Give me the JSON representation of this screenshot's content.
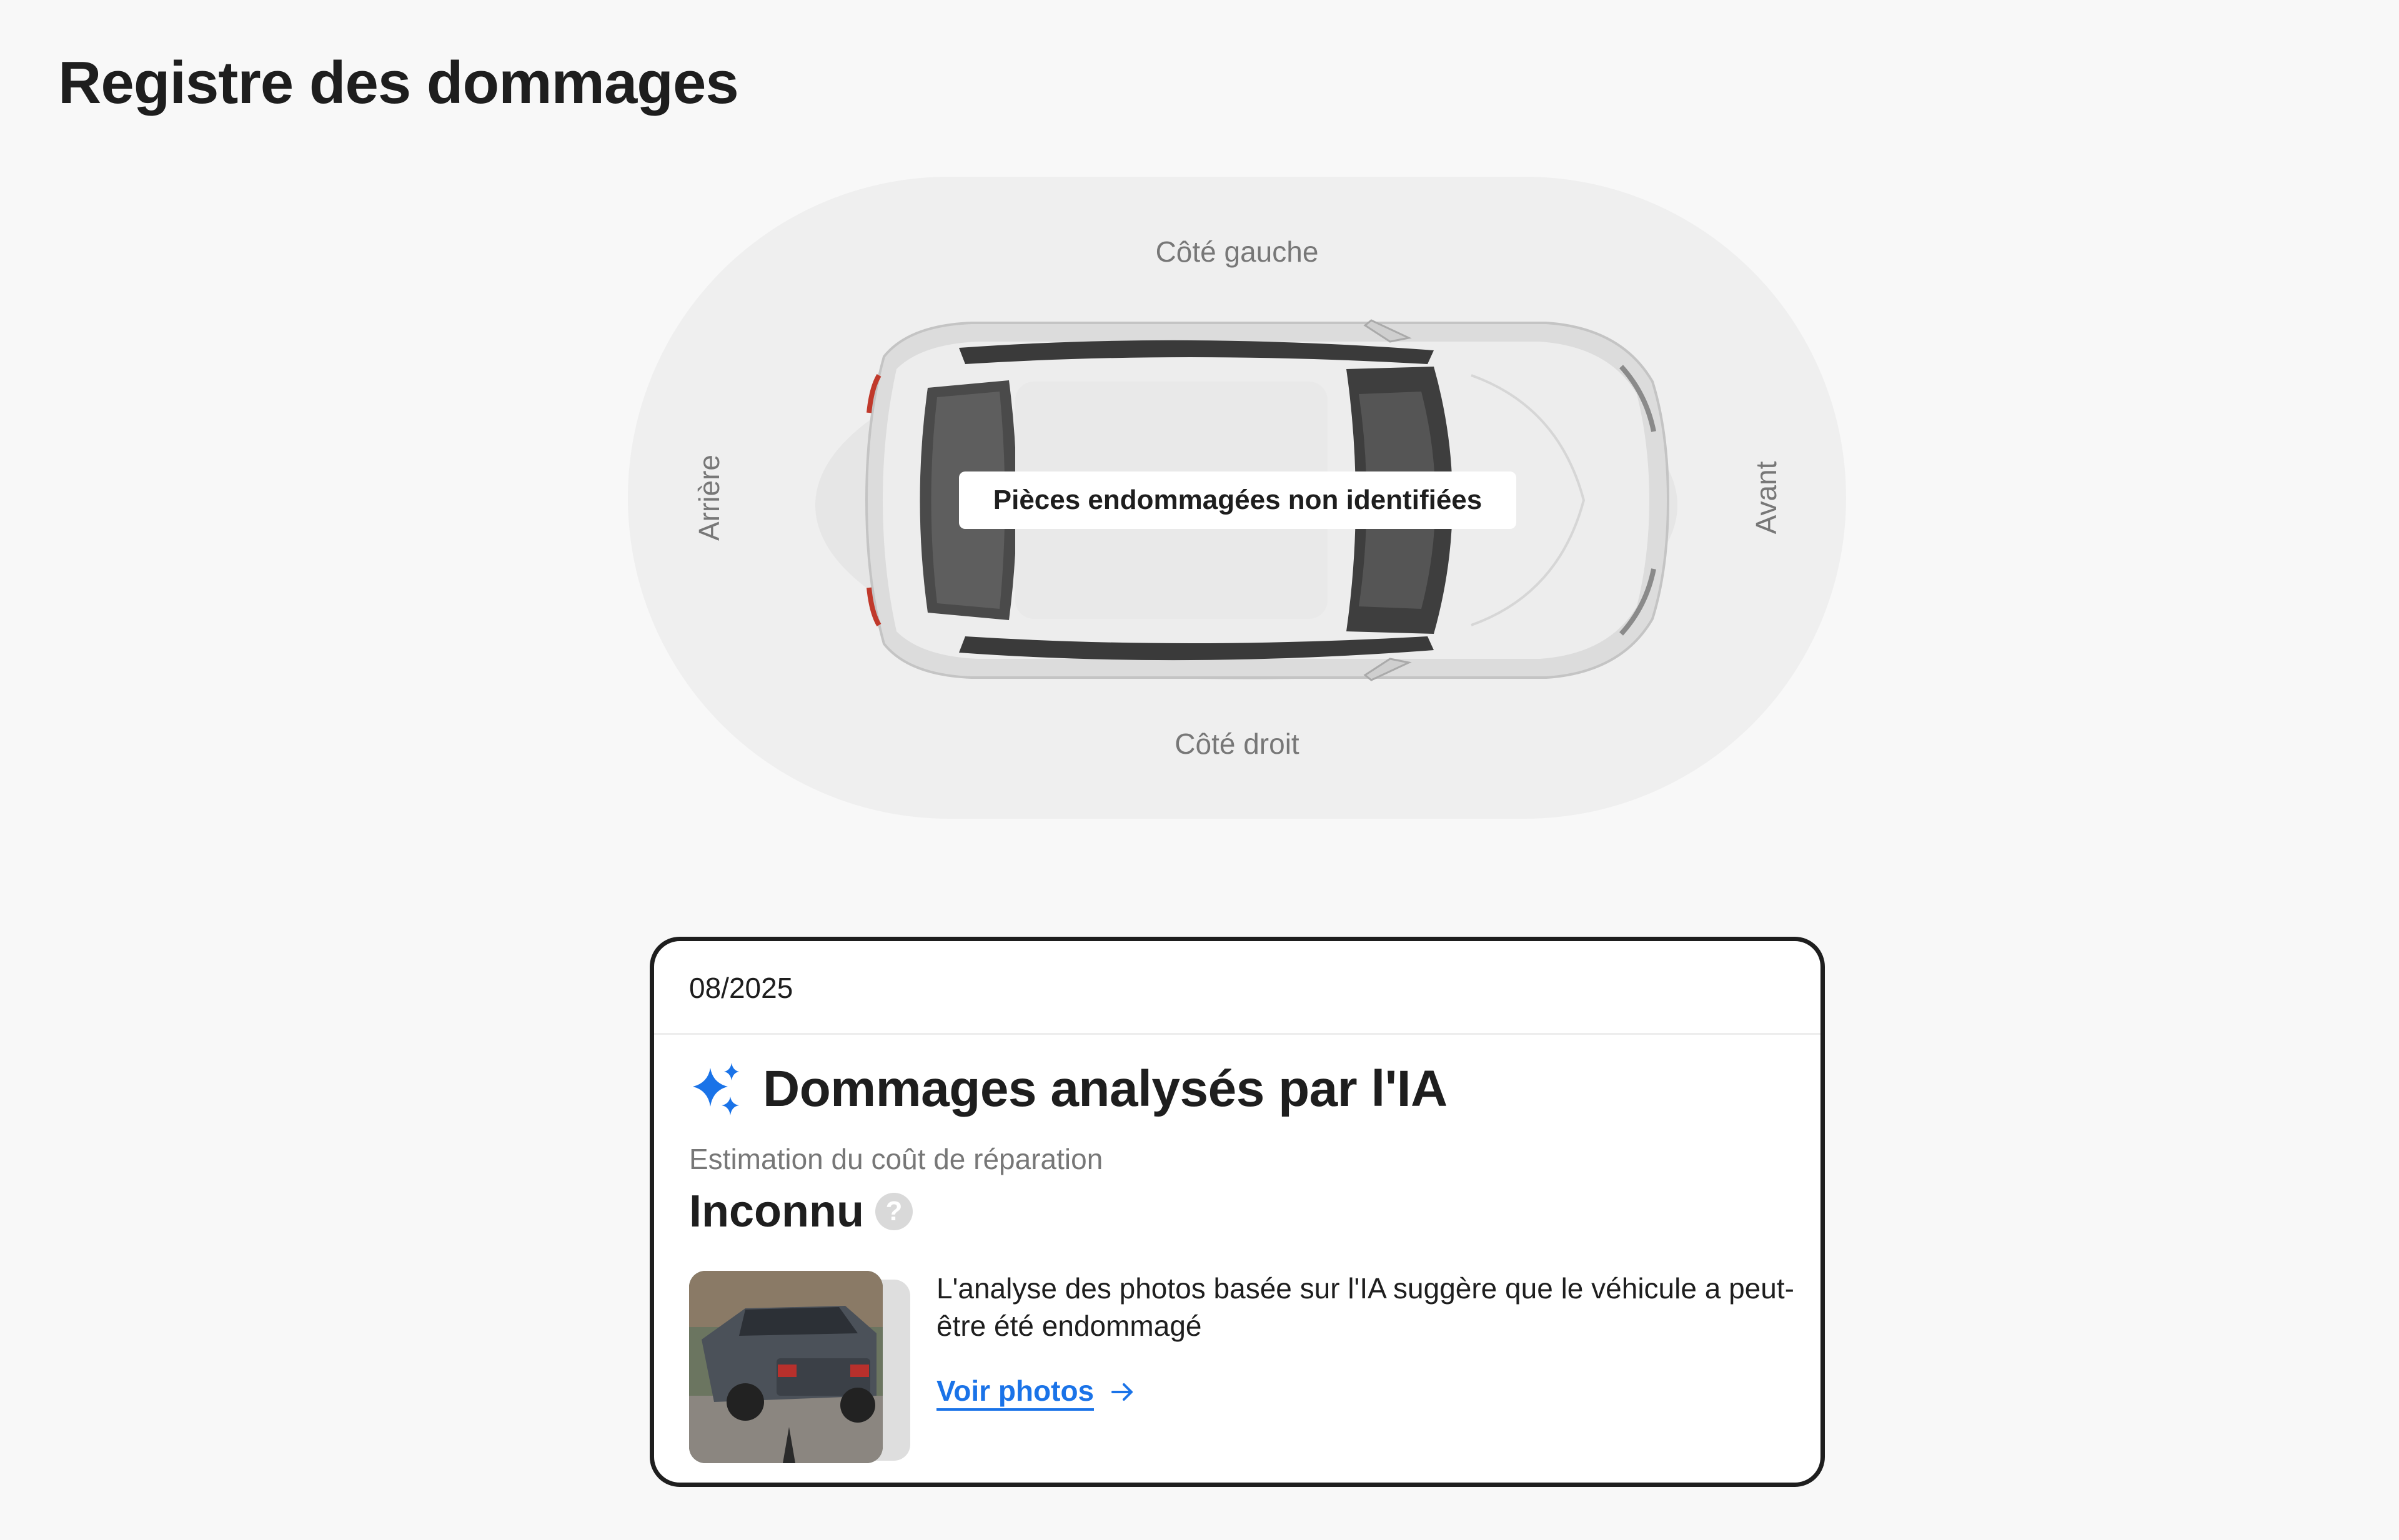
{
  "page": {
    "title": "Registre des dommages"
  },
  "diagram": {
    "left_side_label": "Côté gauche",
    "right_side_label": "Côté droit",
    "rear_label": "Arrière",
    "front_label": "Avant",
    "damage_status": "Pièces endommagées non identifiées"
  },
  "report": {
    "date": "08/2025",
    "ai_title": "Dommages analysés par l'IA",
    "estimate_label": "Estimation du coût de réparation",
    "estimate_value": "Inconnu",
    "help_symbol": "?",
    "description": "L'analyse des photos basée sur l'IA suggère que le véhicule a peut-être été endommagé",
    "link_label": "Voir photos"
  },
  "icons": {
    "sparkle": "sparkle-icon",
    "help": "question-icon",
    "arrow": "arrow-right-icon"
  },
  "colors": {
    "accent": "#1a73e8",
    "text": "#1e1e1e",
    "muted": "#777777",
    "background": "#f8f8f8"
  }
}
